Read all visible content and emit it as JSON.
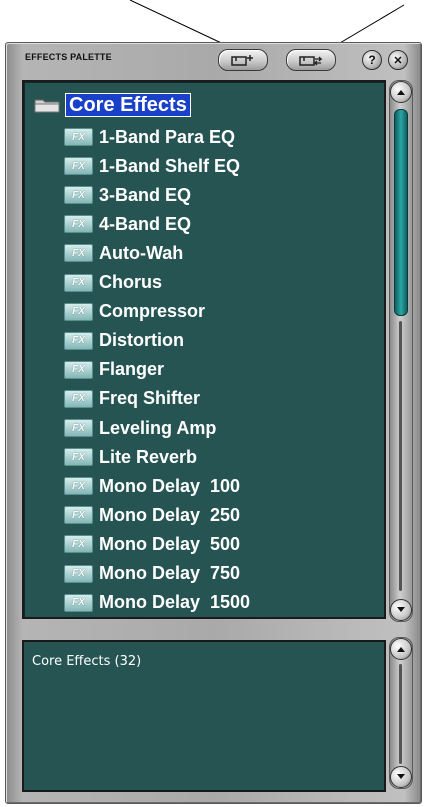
{
  "palette": {
    "title": "EFFECTS PALETTE",
    "buttons": {
      "new_folder_icon": "new-folder-icon",
      "move_icon": "move-folder-icon",
      "help_label": "?",
      "close_label": "✕"
    }
  },
  "tree": {
    "root_label": "Core Effects",
    "fx_badge": "FX",
    "items": [
      "1-Band Para EQ",
      "1-Band Shelf EQ",
      "3-Band EQ",
      "4-Band EQ",
      "Auto-Wah",
      "Chorus",
      "Compressor",
      "Distortion",
      "Flanger",
      "Freq Shifter",
      "Leveling Amp",
      "Lite Reverb",
      "Mono Delay  100",
      "Mono Delay  250",
      "Mono Delay  500",
      "Mono Delay  750",
      "Mono Delay  1500"
    ]
  },
  "info": {
    "text": "Core Effects (32)"
  },
  "colors": {
    "panel_bg": "#255453",
    "selection": "#1840c8",
    "scroll_thumb": "#2aa6a6"
  }
}
